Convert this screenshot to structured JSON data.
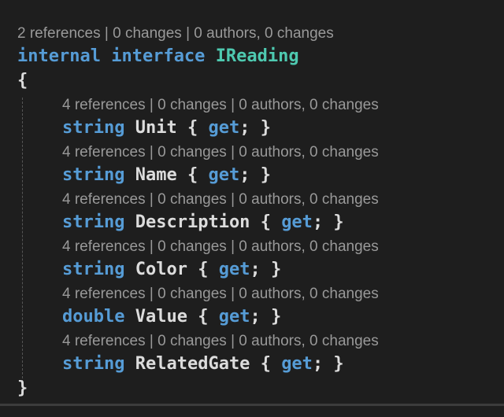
{
  "editor": {
    "interface_lens": "2 references | 0 changes | 0 authors, 0 changes",
    "line1": {
      "kw1": "internal",
      "kw2": "interface",
      "name": "IReading"
    },
    "open_brace": "{",
    "close_brace": "}",
    "members": [
      {
        "lens": "4 references | 0 changes | 0 authors, 0 changes",
        "type": "string",
        "name": "Unit",
        "ob": "{",
        "get": "get",
        "rest": "; }"
      },
      {
        "lens": "4 references | 0 changes | 0 authors, 0 changes",
        "type": "string",
        "name": "Name",
        "ob": "{",
        "get": "get",
        "rest": "; }"
      },
      {
        "lens": "4 references | 0 changes | 0 authors, 0 changes",
        "type": "string",
        "name": "Description",
        "ob": "{",
        "get": "get",
        "rest": "; }"
      },
      {
        "lens": "4 references | 0 changes | 0 authors, 0 changes",
        "type": "string",
        "name": "Color",
        "ob": "{",
        "get": "get",
        "rest": "; }"
      },
      {
        "lens": "4 references | 0 changes | 0 authors, 0 changes",
        "type": "double",
        "name": "Value",
        "ob": "{",
        "get": "get",
        "rest": "; }"
      },
      {
        "lens": "4 references | 0 changes | 0 authors, 0 changes",
        "type": "string",
        "name": "RelatedGate",
        "ob": "{",
        "get": "get",
        "rest": "; }"
      }
    ]
  },
  "colors": {
    "background": "#1e1e1e",
    "keyword": "#569cd6",
    "type_name": "#4ec9b0",
    "identifier": "#dcdcdc",
    "codelens": "#999999"
  }
}
